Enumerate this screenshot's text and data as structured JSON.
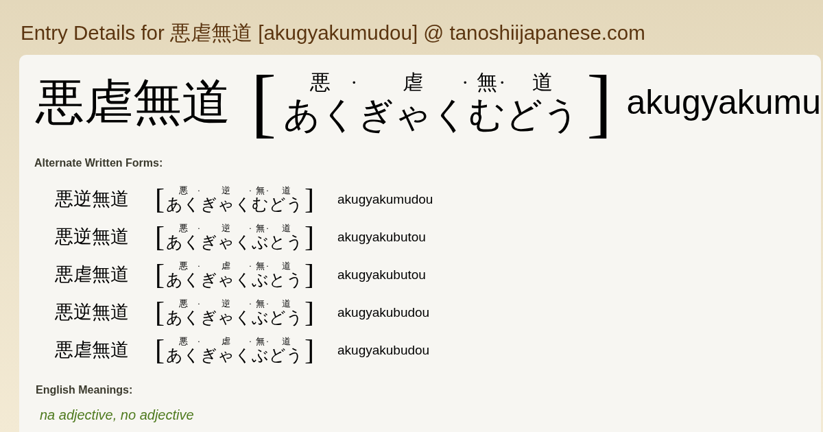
{
  "page_title": "Entry Details for 悪虐無道 [akugyakumudou] @ tanoshiijapanese.com",
  "entry": {
    "word": "悪虐無道",
    "bracket_open": "[",
    "reading": [
      {
        "kanji": "悪",
        "kana": "あく",
        "mark": "·"
      },
      {
        "kanji": "虐",
        "kana": "ぎゃく",
        "mark": "·"
      },
      {
        "kanji": "無",
        "kana": "む",
        "mark": "·"
      },
      {
        "kanji": "道",
        "kana": "どう"
      }
    ],
    "bracket_close": "]",
    "romaji": "akugyakumu"
  },
  "alternate_forms": {
    "heading": "Alternate Written Forms:",
    "forms": [
      {
        "word": "悪逆無道",
        "bracket_open": "[",
        "reading": [
          {
            "kanji": "悪",
            "kana": "あく",
            "mark": "·"
          },
          {
            "kanji": "逆",
            "kana": "ぎゃく",
            "mark": "·"
          },
          {
            "kanji": "無",
            "kana": "む",
            "mark": "·"
          },
          {
            "kanji": "道",
            "kana": "どう"
          }
        ],
        "bracket_close": "]",
        "romaji": "akugyakumudou"
      },
      {
        "word": "悪逆無道",
        "bracket_open": "[",
        "reading": [
          {
            "kanji": "悪",
            "kana": "あく",
            "mark": "·"
          },
          {
            "kanji": "逆",
            "kana": "ぎゃく",
            "mark": "·"
          },
          {
            "kanji": "無",
            "kana": "ぶ",
            "mark": "·"
          },
          {
            "kanji": "道",
            "kana": "とう"
          }
        ],
        "bracket_close": "]",
        "romaji": "akugyakubutou"
      },
      {
        "word": "悪虐無道",
        "bracket_open": "[",
        "reading": [
          {
            "kanji": "悪",
            "kana": "あく",
            "mark": "·"
          },
          {
            "kanji": "虐",
            "kana": "ぎゃく",
            "mark": "·"
          },
          {
            "kanji": "無",
            "kana": "ぶ",
            "mark": "·"
          },
          {
            "kanji": "道",
            "kana": "とう"
          }
        ],
        "bracket_close": "]",
        "romaji": "akugyakubutou"
      },
      {
        "word": "悪逆無道",
        "bracket_open": "[",
        "reading": [
          {
            "kanji": "悪",
            "kana": "あく",
            "mark": "·"
          },
          {
            "kanji": "逆",
            "kana": "ぎゃく",
            "mark": "·"
          },
          {
            "kanji": "無",
            "kana": "ぶ",
            "mark": "·"
          },
          {
            "kanji": "道",
            "kana": "どう"
          }
        ],
        "bracket_close": "]",
        "romaji": "akugyakubudou"
      },
      {
        "word": "悪虐無道",
        "bracket_open": "[",
        "reading": [
          {
            "kanji": "悪",
            "kana": "あく",
            "mark": "·"
          },
          {
            "kanji": "虐",
            "kana": "ぎゃく",
            "mark": "·"
          },
          {
            "kanji": "無",
            "kana": "ぶ",
            "mark": "·"
          },
          {
            "kanji": "道",
            "kana": "どう"
          }
        ],
        "bracket_close": "]",
        "romaji": "akugyakubudou"
      }
    ]
  },
  "english_meanings": {
    "heading": "English Meanings:",
    "parts_of_speech": "na adjective, no adjective"
  }
}
